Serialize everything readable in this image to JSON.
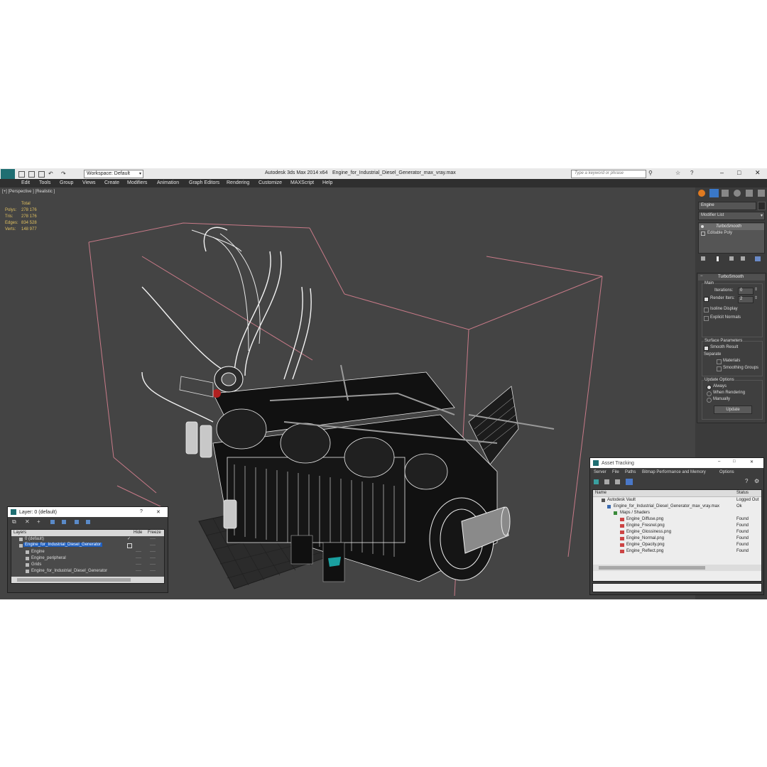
{
  "titlebar": {
    "workspace_label": "Workspace: Default",
    "app_title": "Autodesk 3ds Max  2014 x64",
    "file_name": "Engine_for_Industrial_Diesel_Generator_max_vray.max",
    "search_placeholder": "Type a keyword or phrase",
    "help_icon": "?",
    "minimize": "–",
    "maximize": "□",
    "close": "✕"
  },
  "menu": [
    "Edit",
    "Tools",
    "Group",
    "Views",
    "Create",
    "Modifiers",
    "Animation",
    "Graph Editors",
    "Rendering",
    "Customize",
    "MAXScript",
    "Help"
  ],
  "viewport": {
    "label": "[+] [Perspective ] [Realistic ]",
    "stats": {
      "header": "Total",
      "rows": [
        {
          "label": "Polys:",
          "value": "278 176"
        },
        {
          "label": "Tris:",
          "value": "278 176"
        },
        {
          "label": "Edges:",
          "value": "834 528"
        },
        {
          "label": "Verts:",
          "value": "148 977"
        }
      ]
    }
  },
  "command_panel": {
    "object_name": "Engine",
    "modifier_list": "Modifier List",
    "stack": [
      "TurboSmooth",
      "Editable Poly"
    ],
    "rollout_title": "TurboSmooth",
    "main_group": "Main",
    "iterations_label": "Iterations:",
    "iterations_value": "0",
    "render_iters_label": "Render Iters:",
    "render_iters_value": "2",
    "isoline_display": "Isoline Display",
    "explicit_normals": "Explicit Normals",
    "surface_parameters": "Surface Parameters",
    "smooth_result": "Smooth Result",
    "separate": "Separate",
    "materials": "Materials",
    "smoothing_groups": "Smoothing Groups",
    "update_options": "Update Options",
    "always": "Always",
    "when_rendering": "When Rendering",
    "manually": "Manually",
    "update_button": "Update"
  },
  "layer_window": {
    "title": "Layer: 0 (default)",
    "help": "?",
    "close": "✕",
    "columns": {
      "layers": "Layers",
      "hide": "Hide",
      "freeze": "Freeze"
    },
    "rows": [
      {
        "name": "0 (default)",
        "hide": "✓",
        "freeze": "----"
      },
      {
        "name": "Engine_for_Industrial_Diesel_Generator",
        "hide": "",
        "freeze": "----"
      },
      {
        "name": "Engine",
        "hide": "----",
        "freeze": "----"
      },
      {
        "name": "Engine_peripheral",
        "hide": "----",
        "freeze": "----"
      },
      {
        "name": "Grids",
        "hide": "----",
        "freeze": "----"
      },
      {
        "name": "Engine_for_Industrial_Diesel_Generator",
        "hide": "----",
        "freeze": "----"
      }
    ]
  },
  "asset_window": {
    "title": "Asset Tracking",
    "menu": [
      "Server",
      "File",
      "Paths",
      "Bitmap Performance and Memory",
      "Options"
    ],
    "columns": {
      "name": "Name",
      "status": "Status"
    },
    "rows": [
      {
        "name": "Autodesk Vault",
        "status": "Logged Out"
      },
      {
        "name": "Engine_for_Industrial_Diesel_Generator_max_vray.max",
        "status": "Ok"
      },
      {
        "name": "Maps / Shaders",
        "status": ""
      },
      {
        "name": "Engine_Diffuse.png",
        "status": "Found"
      },
      {
        "name": "Engine_Fresnel.png",
        "status": "Found"
      },
      {
        "name": "Engine_Glossiness.png",
        "status": "Found"
      },
      {
        "name": "Engine_Normal.png",
        "status": "Found"
      },
      {
        "name": "Engine_Opacity.png",
        "status": "Found"
      },
      {
        "name": "Engine_Reflect.png",
        "status": "Found"
      }
    ]
  },
  "colors": {
    "viewport_bg": "#444444",
    "stats_text": "#e0c060",
    "bounding_box": "#d08090",
    "selection": "#1f5fbf",
    "teal_logo": "#1aa0a0"
  }
}
